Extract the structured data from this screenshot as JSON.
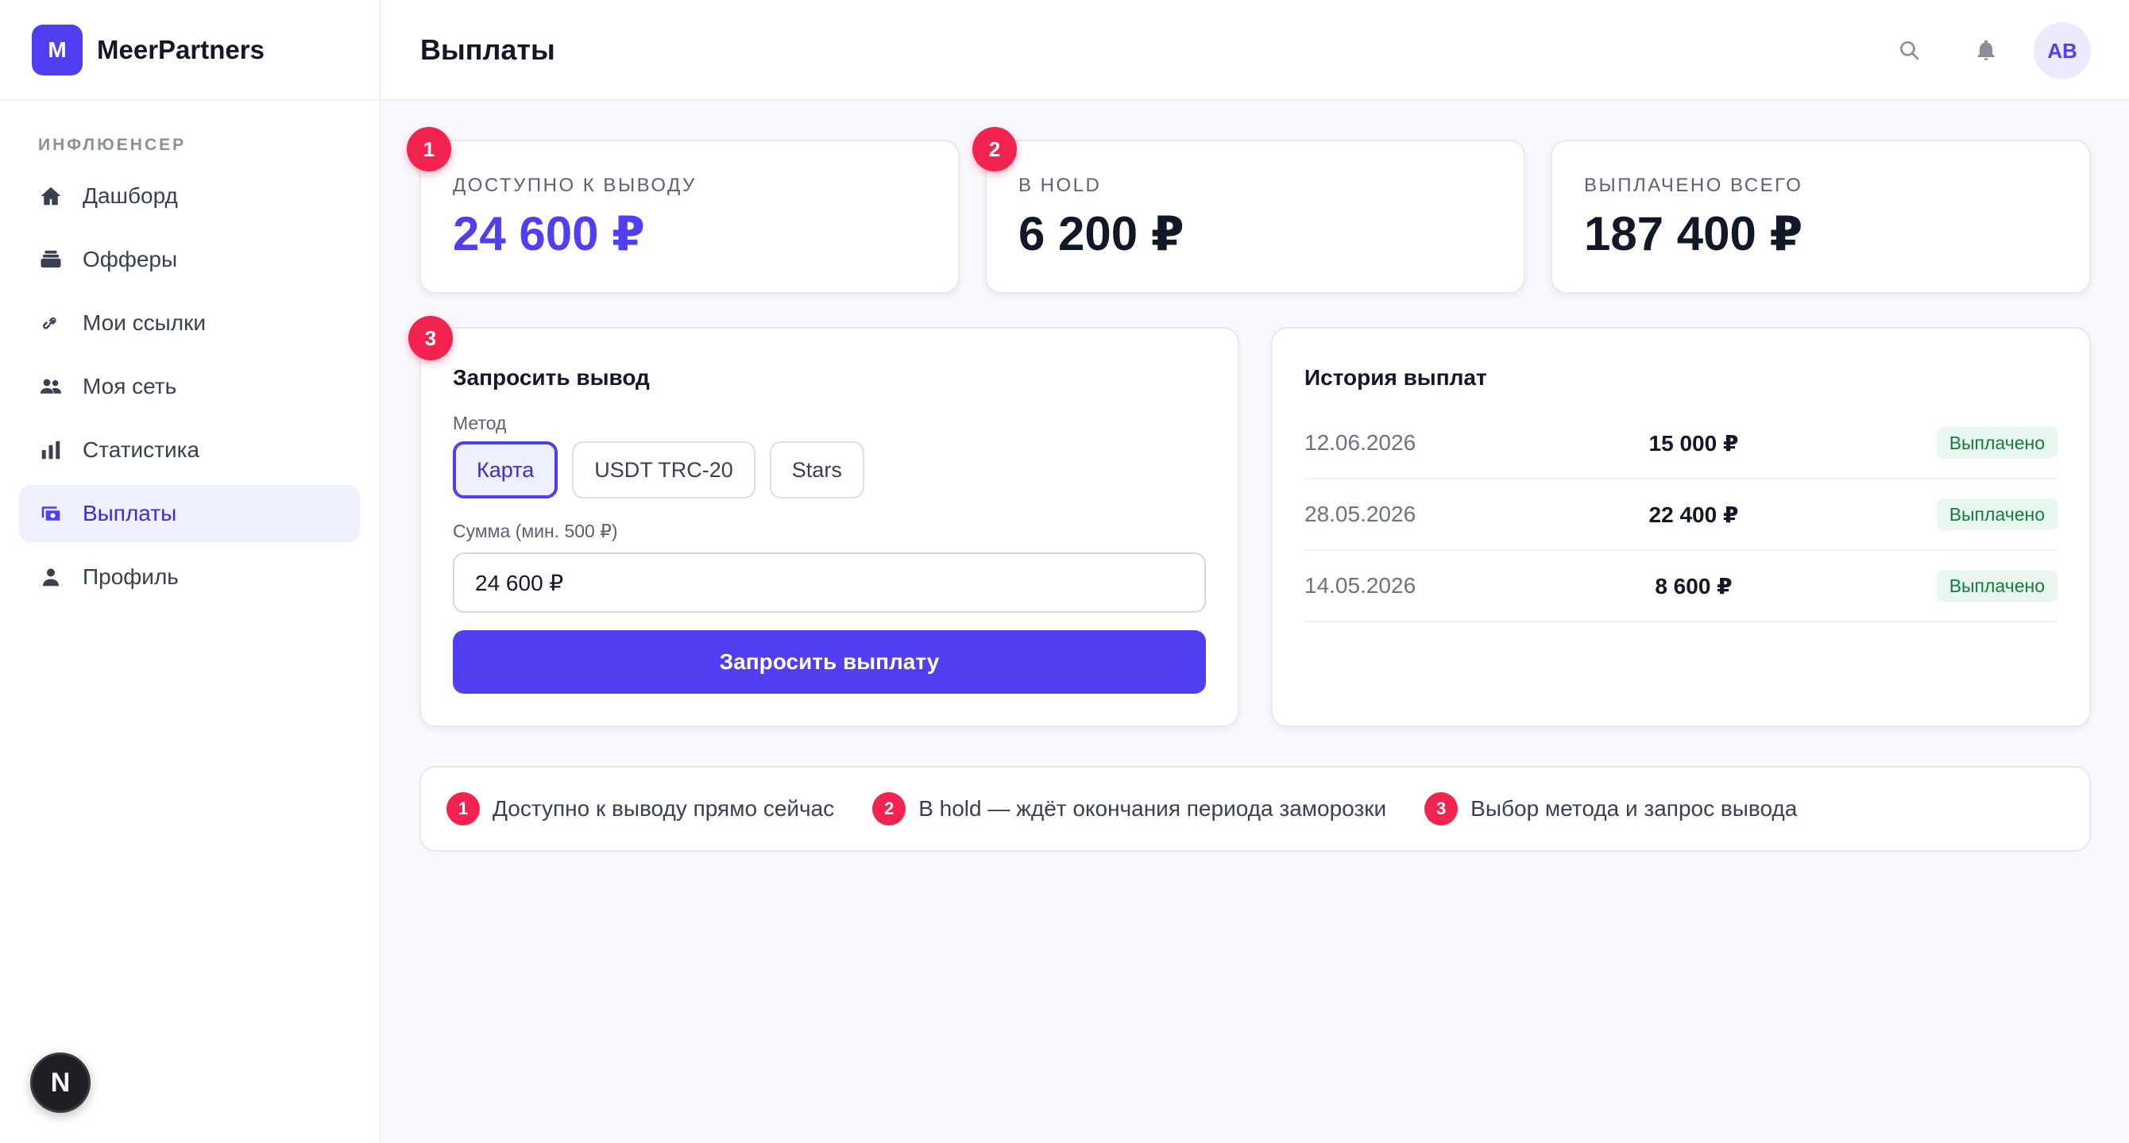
{
  "brand": {
    "logo_letter": "M",
    "name": "MeerPartners"
  },
  "sidebar": {
    "section_label": "ИНФЛЮЕНСЕР",
    "items": [
      {
        "label": "Дашборд",
        "icon": "home-icon"
      },
      {
        "label": "Офферы",
        "icon": "stack-icon"
      },
      {
        "label": "Мои ссылки",
        "icon": "link-icon"
      },
      {
        "label": "Моя сеть",
        "icon": "users-icon"
      },
      {
        "label": "Статистика",
        "icon": "bar-chart-icon"
      },
      {
        "label": "Выплаты",
        "icon": "payments-icon",
        "active": true
      },
      {
        "label": "Профиль",
        "icon": "person-icon"
      }
    ]
  },
  "header": {
    "title": "Выплаты",
    "avatar_initials": "AB"
  },
  "stats": {
    "available": {
      "marker": "1",
      "label": "ДОСТУПНО К ВЫВОДУ",
      "value": "24 600 ₽"
    },
    "hold": {
      "marker": "2",
      "label": "В HOLD",
      "value": "6 200 ₽"
    },
    "paid_total": {
      "label": "ВЫПЛАЧЕНО ВСЕГО",
      "value": "187 400 ₽"
    }
  },
  "withdraw": {
    "marker": "3",
    "title": "Запросить вывод",
    "method_label": "Метод",
    "methods": [
      "Карта",
      "USDT TRC-20",
      "Stars"
    ],
    "selected_method": "Карта",
    "amount_label": "Сумма (мин. 500 ₽)",
    "amount_value": "24 600 ₽",
    "submit_label": "Запросить выплату"
  },
  "history": {
    "title": "История выплат",
    "rows": [
      {
        "date": "12.06.2026",
        "amount": "15 000 ₽",
        "status": "Выплачено"
      },
      {
        "date": "28.05.2026",
        "amount": "22 400 ₽",
        "status": "Выплачено"
      },
      {
        "date": "14.05.2026",
        "amount": "8 600 ₽",
        "status": "Выплачено"
      }
    ]
  },
  "legend": [
    {
      "num": "1",
      "text": "Доступно к выводу прямо сейчас"
    },
    {
      "num": "2",
      "text": "В hold — ждёт окончания периода заморозки"
    },
    {
      "num": "3",
      "text": "Выбор метода и запрос вывода"
    }
  ],
  "dev_badge": {
    "letter": "N"
  },
  "colors": {
    "accent": "#4f3ff0",
    "marker": "#f2234f",
    "success_bg": "#e8f8ee",
    "success_text": "#157a3d"
  }
}
